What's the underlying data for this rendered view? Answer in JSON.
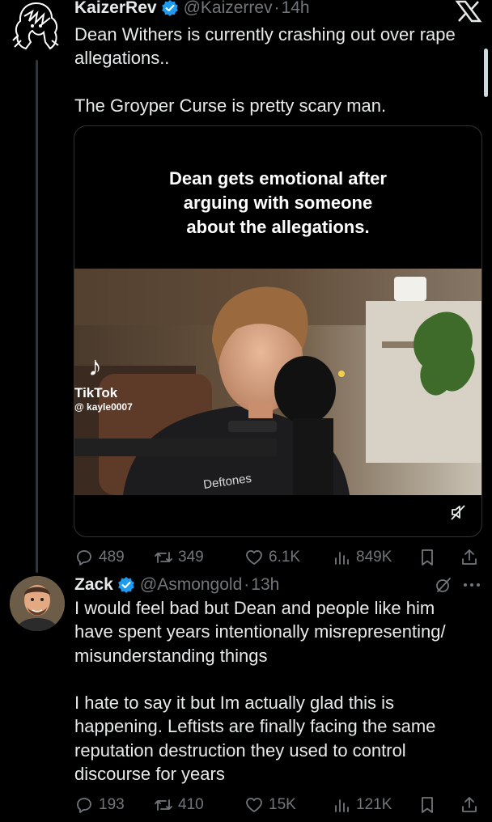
{
  "tweet1": {
    "display_name": "KaizerRev",
    "handle": "@Kaizerrev",
    "separator": "·",
    "time": "14h",
    "text": "Dean Withers is currently crashing out over rape\nallegations..\n\nThe Groyper Curse is pretty scary man.",
    "media": {
      "caption": "Dean gets emotional after\narguing with someone\nabout the allegations.",
      "tiktok_brand": "TikTok",
      "tiktok_user": "@ kayle0007",
      "shirt_text": "Deftones"
    },
    "stats": {
      "replies": "489",
      "reposts": "349",
      "likes": "6.1K",
      "views": "849K"
    }
  },
  "tweet2": {
    "display_name": "Zack",
    "handle": "@Asmongold",
    "separator": "·",
    "time": "13h",
    "text": "I would feel bad but Dean and people like him\nhave spent years intentionally misrepresenting/\nmisunderstanding things\n\nI hate to say it but Im actually glad this is\nhappening. Leftists are finally facing the same\nreputation destruction they used to control\ndiscourse for years",
    "stats": {
      "replies": "193",
      "reposts": "410",
      "likes": "15K",
      "views": "121K"
    }
  },
  "colors": {
    "background": "#000000",
    "text": "#e7e9ea",
    "muted": "#71767b",
    "verified": "#1d9bf0",
    "border": "#2f3336"
  },
  "icons": [
    "x-logo-icon",
    "verified-badge-icon",
    "reply-icon",
    "repost-icon",
    "like-icon",
    "views-icon",
    "bookmark-icon",
    "share-icon",
    "grok-icon",
    "more-icon",
    "mute-icon",
    "tiktok-logo-icon"
  ]
}
